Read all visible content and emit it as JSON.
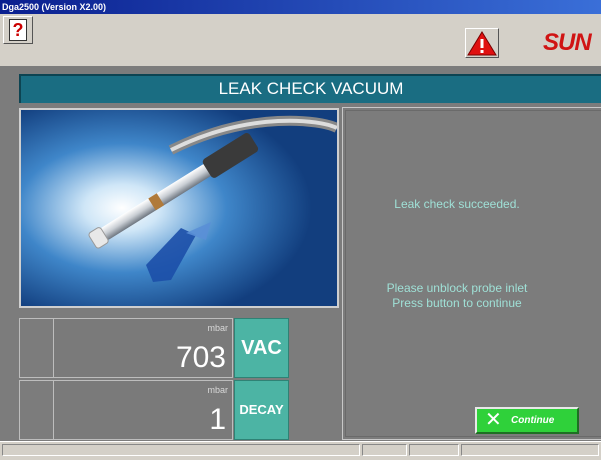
{
  "window": {
    "title": "Dga2500 (Version X2.00)"
  },
  "toolbar": {
    "help_icon": "question-icon",
    "warning_icon": "warning-triangle-icon",
    "logo_text": "SUN"
  },
  "heading": "LEAK CHECK VACUUM",
  "readouts": [
    {
      "unit": "mbar",
      "value": "703",
      "mode": "VAC"
    },
    {
      "unit": "mbar",
      "value": "1",
      "mode": "DECAY"
    }
  ],
  "messages": {
    "result": "Leak check succeeded.",
    "line1": "Please unblock probe inlet",
    "line2": "Press button to continue"
  },
  "continue_button": {
    "label": "Continue",
    "icon": "x-icon"
  },
  "colors": {
    "heading_bg": "#1a6d82",
    "mode_button": "#4cb4a4",
    "message_text": "#9fe0d6",
    "continue_bg": "#2fd13a"
  }
}
